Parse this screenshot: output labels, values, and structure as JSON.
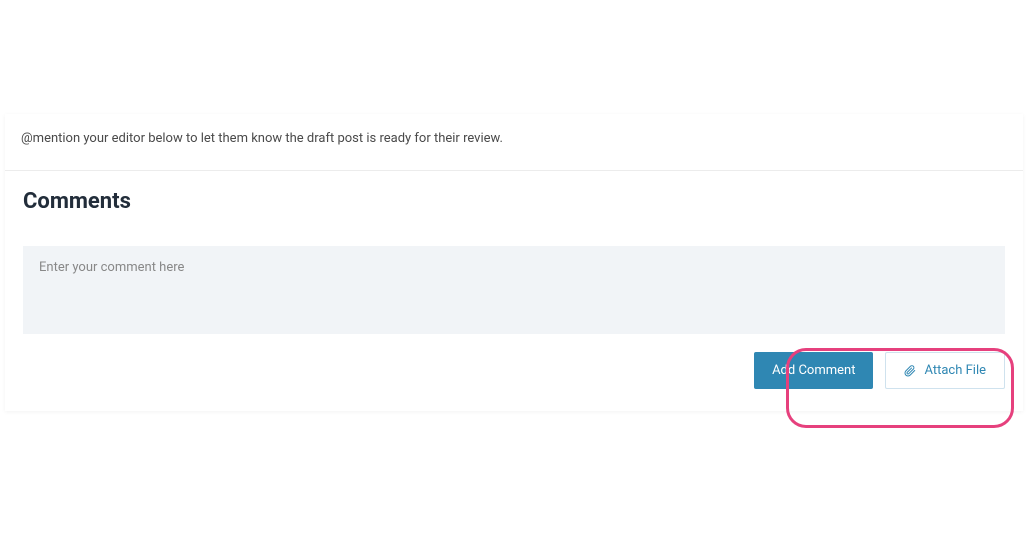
{
  "instruction": "@mention your editor below to let them know the draft post is ready for their review.",
  "comments": {
    "heading": "Comments",
    "placeholder": "Enter your comment here"
  },
  "actions": {
    "add_comment_label": "Add Comment",
    "attach_file_label": "Attach File"
  }
}
